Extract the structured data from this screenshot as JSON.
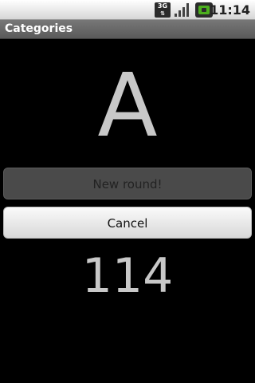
{
  "status_bar": {
    "network": "3G",
    "time": "11:14",
    "icons": [
      "3g-data-icon",
      "signal-strength-icon",
      "battery-icon"
    ]
  },
  "title_bar": {
    "title": "Categories"
  },
  "main": {
    "letter": "A",
    "new_round_label": "New round!",
    "cancel_label": "Cancel",
    "counter": "114"
  }
}
